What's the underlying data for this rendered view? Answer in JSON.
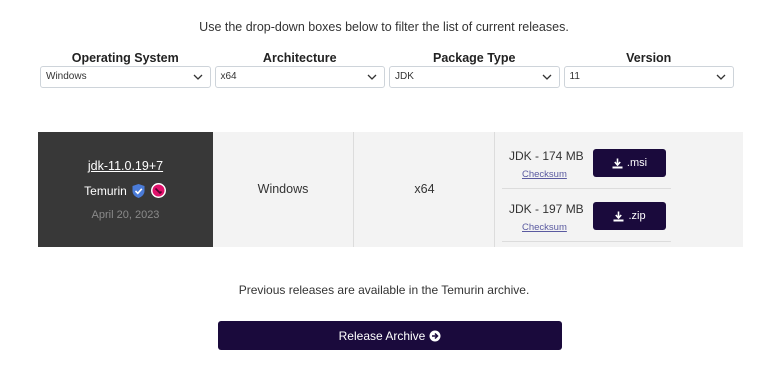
{
  "intro": "Use the drop-down boxes below to filter the list of current releases.",
  "filters": [
    {
      "label": "Operating System",
      "value": "Windows"
    },
    {
      "label": "Architecture",
      "value": "x64"
    },
    {
      "label": "Package Type",
      "value": "JDK"
    },
    {
      "label": "Version",
      "value": "11"
    }
  ],
  "release": {
    "name": "jdk-11.0.19+7",
    "vendor": "Temurin",
    "date": "April 20, 2023",
    "os": "Windows",
    "arch": "x64",
    "downloads": [
      {
        "size": "JDK - 174 MB",
        "checksum": "Checksum",
        "button": ".msi"
      },
      {
        "size": "JDK - 197 MB",
        "checksum": "Checksum",
        "button": ".zip"
      }
    ]
  },
  "archive": {
    "text": "Previous releases are available in the Temurin archive.",
    "button": "Release Archive"
  },
  "colors": {
    "brand_dark": "#1a0a3c",
    "release_cell": "#383838",
    "row_bg": "#f3f3f3",
    "badge_blue": "#4a7bd8",
    "badge_pink": "#e0116b"
  }
}
